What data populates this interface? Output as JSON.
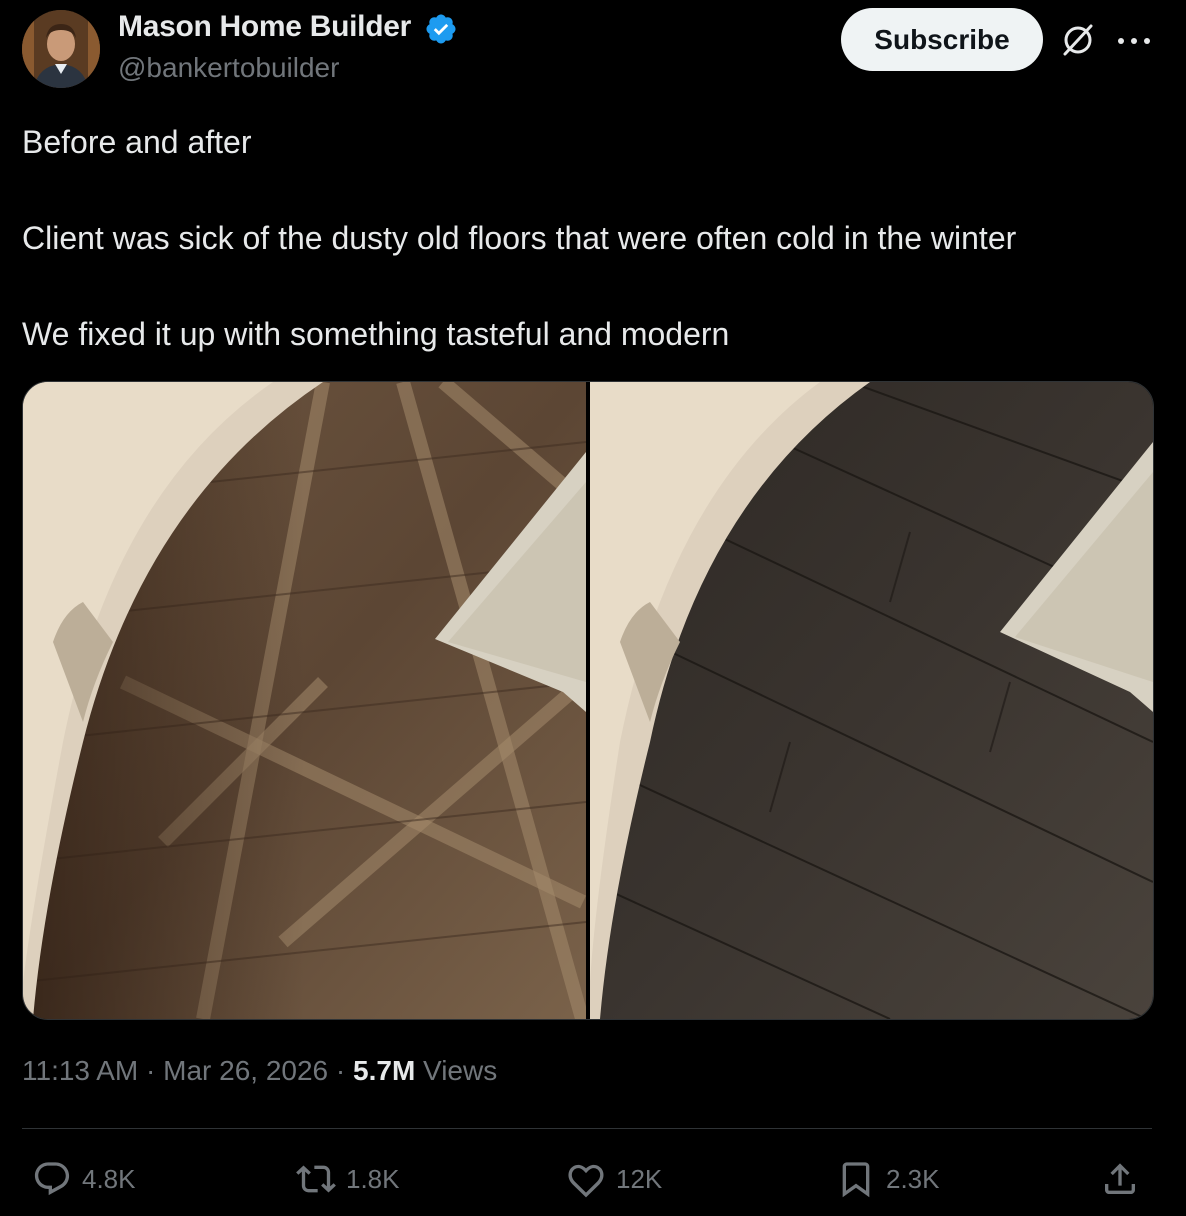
{
  "author": {
    "name": "Mason Home Builder",
    "handle": "@bankertobuilder",
    "verified_color": "#1d9bf0"
  },
  "header": {
    "subscribe_label": "Subscribe",
    "grok_icon": "grok-icon",
    "more_icon": "more-icon"
  },
  "tweet": {
    "lines": [
      "Before and after",
      "Client was sick of the dusty old floors that were often cold in the winter",
      "We fixed it up with something tasteful and modern"
    ]
  },
  "media": {
    "photos": [
      {
        "name": "before-floor-photo",
        "subject": "parquet floor with rug"
      },
      {
        "name": "after-floor-photo",
        "subject": "dark plank floor with rug"
      }
    ]
  },
  "meta": {
    "time": "11:13 AM",
    "separator": " · ",
    "date": "Mar 26, 2026",
    "views_count": "5.7M",
    "views_label": " Views"
  },
  "actions": {
    "replies": "4.8K",
    "retweets": "1.8K",
    "likes": "12K",
    "bookmarks": "2.3K"
  },
  "colors": {
    "background": "#000000",
    "text": "#e7e9ea",
    "muted": "#71767b",
    "accent": "#1d9bf0"
  }
}
